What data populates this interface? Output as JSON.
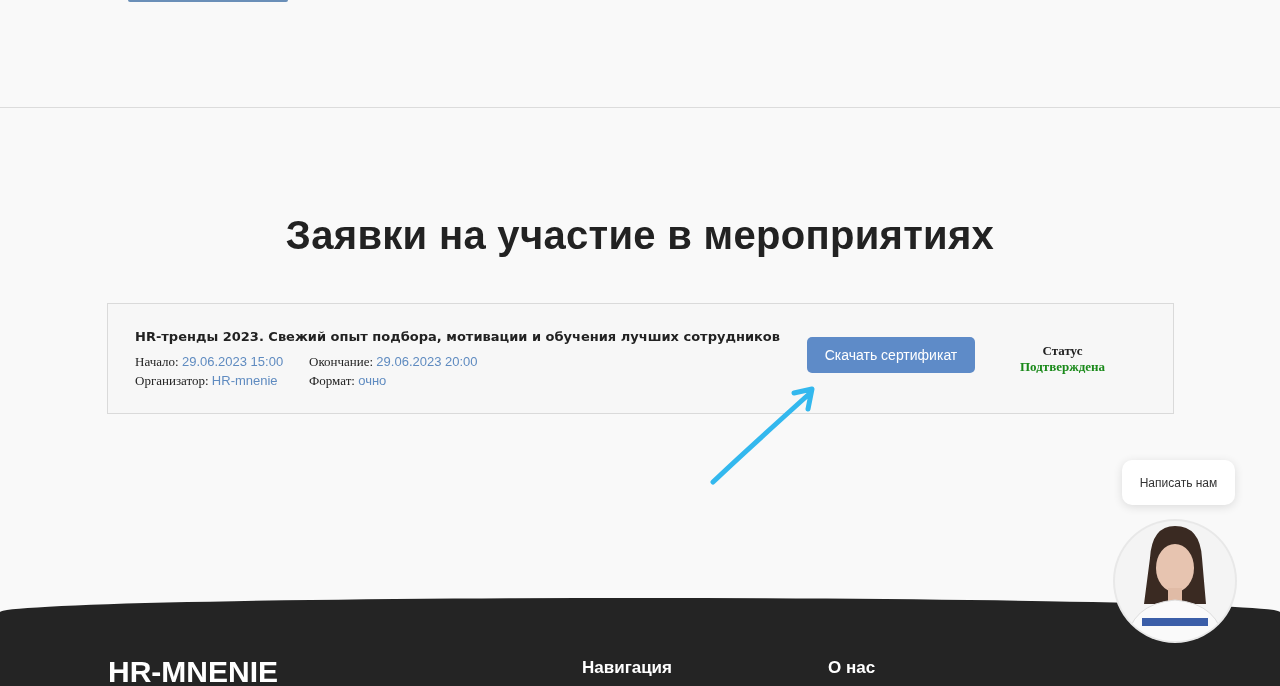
{
  "heading": "Заявки на участие в мероприятиях",
  "applications": [
    {
      "title": "HR-тренды 2023. Свежий опыт подбора, мотивации и обучения лучших сотрудников",
      "fields": [
        {
          "label": "Начало:",
          "value": "29.06.2023 15:00"
        },
        {
          "label": "Окончание:",
          "value": "29.06.2023 20:00"
        },
        {
          "label": "Организатор:",
          "value": "HR-mnenie"
        },
        {
          "label": "Формат:",
          "value": "очно"
        }
      ],
      "button": "Скачать сертификат",
      "status_label": "Статус",
      "status": "Подтверждена",
      "color": "#1a8a1a"
    }
  ],
  "chat": {
    "bubble": "Написать нам"
  },
  "footer": {
    "logo": "HR-MNENIE",
    "columns": [
      "Навигация",
      "О нас"
    ]
  }
}
